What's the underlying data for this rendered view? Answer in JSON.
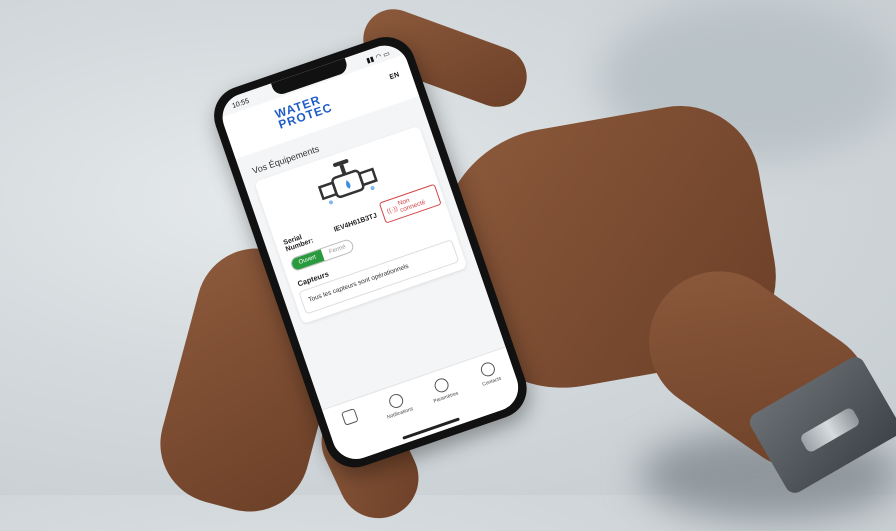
{
  "status_bar": {
    "time": "10:55"
  },
  "header": {
    "logo_line1": "WATER",
    "logo_line2": "PROTEC",
    "lang": "EN"
  },
  "equipment": {
    "section_title": "Vos Équipements",
    "serial_label": "Serial Number:",
    "serial_value": "IEV4H61B3TJ",
    "connection_status": "Non connecté",
    "toggle_open": "Ouvert",
    "toggle_closed": "Fermé",
    "sensors_title": "Capteurs",
    "sensors_status": "Tous les capteurs sont opérationnels"
  },
  "tabs": [
    {
      "label": "",
      "icon": "valve-icon"
    },
    {
      "label": "Notifications",
      "icon": "bell-icon"
    },
    {
      "label": "Paramètres",
      "icon": "gear-icon"
    },
    {
      "label": "Contacts",
      "icon": "contact-icon"
    }
  ],
  "colors": {
    "brand": "#1e5bc8",
    "open_green": "#2a9a3f",
    "alert_red": "#d64545"
  }
}
